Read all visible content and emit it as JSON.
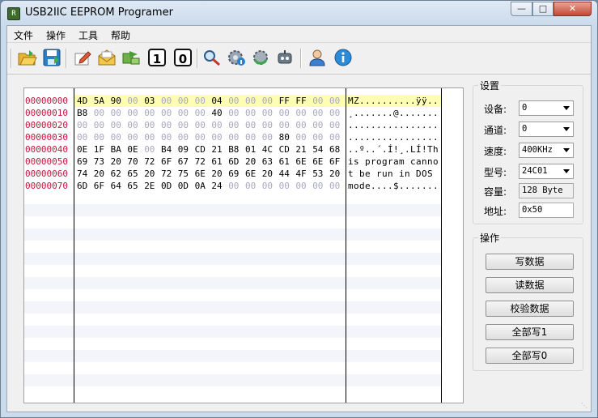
{
  "window": {
    "title": "USB2IIC EEPROM Programer",
    "app_icon": "R"
  },
  "menu": [
    {
      "label": "文件"
    },
    {
      "label": "操作"
    },
    {
      "label": "工具"
    },
    {
      "label": "帮助"
    }
  ],
  "toolbar": {
    "icons": [
      "open-folder-icon",
      "save-icon",
      "edit-icon",
      "open-envelope-icon",
      "transfer-icon"
    ],
    "digit_one": "1",
    "digit_zero": "0",
    "icons2": [
      "search-key-icon",
      "settings-info-icon",
      "refresh-gear-icon",
      "robot-icon",
      "user-icon",
      "info-icon"
    ]
  },
  "hex_view": {
    "rows": [
      {
        "addr": "00000000",
        "bytes": [
          "4D",
          "5A",
          "90",
          "00",
          "03",
          "00",
          "00",
          "00",
          "04",
          "00",
          "00",
          "00",
          "FF",
          "FF",
          "00",
          "00"
        ],
        "ascii": "MZ..........ÿÿ.."
      },
      {
        "addr": "00000010",
        "bytes": [
          "B8",
          "00",
          "00",
          "00",
          "00",
          "00",
          "00",
          "00",
          "40",
          "00",
          "00",
          "00",
          "00",
          "00",
          "00",
          "00"
        ],
        "ascii": "¸.......@......."
      },
      {
        "addr": "00000020",
        "bytes": [
          "00",
          "00",
          "00",
          "00",
          "00",
          "00",
          "00",
          "00",
          "00",
          "00",
          "00",
          "00",
          "00",
          "00",
          "00",
          "00"
        ],
        "ascii": "................"
      },
      {
        "addr": "00000030",
        "bytes": [
          "00",
          "00",
          "00",
          "00",
          "00",
          "00",
          "00",
          "00",
          "00",
          "00",
          "00",
          "00",
          "80",
          "00",
          "00",
          "00"
        ],
        "ascii": "................"
      },
      {
        "addr": "00000040",
        "bytes": [
          "0E",
          "1F",
          "BA",
          "0E",
          "00",
          "B4",
          "09",
          "CD",
          "21",
          "B8",
          "01",
          "4C",
          "CD",
          "21",
          "54",
          "68"
        ],
        "ascii": "..º..´.Í!¸.LÍ!Th"
      },
      {
        "addr": "00000050",
        "bytes": [
          "69",
          "73",
          "20",
          "70",
          "72",
          "6F",
          "67",
          "72",
          "61",
          "6D",
          "20",
          "63",
          "61",
          "6E",
          "6E",
          "6F"
        ],
        "ascii": "is program canno"
      },
      {
        "addr": "00000060",
        "bytes": [
          "74",
          "20",
          "62",
          "65",
          "20",
          "72",
          "75",
          "6E",
          "20",
          "69",
          "6E",
          "20",
          "44",
          "4F",
          "53",
          "20"
        ],
        "ascii": "t be run in DOS "
      },
      {
        "addr": "00000070",
        "bytes": [
          "6D",
          "6F",
          "64",
          "65",
          "2E",
          "0D",
          "0D",
          "0A",
          "24",
          "00",
          "00",
          "00",
          "00",
          "00",
          "00",
          "00"
        ],
        "ascii": "mode....$......."
      }
    ]
  },
  "settings": {
    "title": "设置",
    "device_label": "设备:",
    "device_value": "0",
    "channel_label": "通道:",
    "channel_value": "0",
    "speed_label": "速度:",
    "speed_value": "400KHz",
    "model_label": "型号:",
    "model_value": "24C01",
    "capacity_label": "容量:",
    "capacity_value": "128 Byte",
    "address_label": "地址:",
    "address_value": "0x50"
  },
  "operations": {
    "title": "操作",
    "write_data": "写数据",
    "read_data": "读数据",
    "verify_data": "校验数据",
    "write_all_1": "全部写1",
    "write_all_0": "全部写0"
  },
  "colors": {
    "address": "#c0143c",
    "highlight": "#fdfdb4",
    "zero_byte": "#a8a8c0"
  }
}
